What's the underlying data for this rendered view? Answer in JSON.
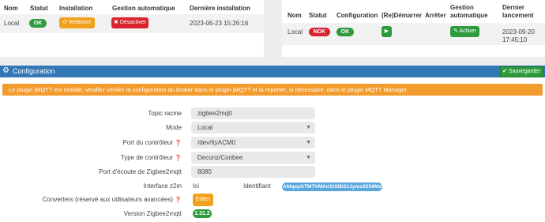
{
  "installation": {
    "headers": {
      "nom": "Nom",
      "statut": "Statut",
      "installation": "Installation",
      "gestion": "Gestion automatique",
      "derniere": "Dernière installation"
    },
    "row": {
      "nom": "Local",
      "statut": "OK",
      "relancer": "Relancer",
      "desactiver": "Désactiver",
      "date": "2023-06-23 15:26:16"
    }
  },
  "demon": {
    "headers": {
      "nom": "Nom",
      "statut": "Statut",
      "configuration": "Configuration",
      "redemarrer": "(Re)Démarrer",
      "arreter": "Arrêter",
      "gestion_l1": "Gestion",
      "gestion_l2": "automatique",
      "dernier_l1": "Dernier",
      "dernier_l2": "lancement"
    },
    "row": {
      "nom": "Local",
      "statut": "NOK",
      "configuration": "OK",
      "activer": "Activer",
      "date_l1": "2023-09-20",
      "date_l2": "17:45:10"
    }
  },
  "config": {
    "title": "Configuration",
    "save_label": "Sauvegarder",
    "alert": "Le plugin jMQTT est installé, veuillez vérifier la configuration du broker dans le plugin jMQTT et la reporter, si nécessaire, dans le plugin MQTT Manager.",
    "fields": {
      "topic_label": "Topic racine",
      "topic_value": "zigbee2mqtt",
      "mode_label": "Mode",
      "mode_value": "Local",
      "port_label": "Port du contrôleur",
      "port_value": "/dev/ttyACM0",
      "type_label": "Type de contrôleur",
      "type_value": "Deconz/Conbee",
      "ecoute_label": "Port d'écoute de Zigbee2mqtt",
      "ecoute_value": "8080",
      "interface_label": "Interface z2m",
      "interface_value": "Ici",
      "identifiant_label": "Identifiant",
      "identifiant_value": "AfdqepGTMTVMArISiSlDS1Jyms3S58Md",
      "converters_label": "Converters (réservé aux utilisateurs avancées)",
      "converters_button": "Editer",
      "version_label": "Version Zigbee2mqtt",
      "version_value": "1.31.2"
    }
  },
  "colors": {
    "header_blue": "#3477b5",
    "alert_orange": "#f39c2e",
    "ok_green": "#2e9b3c",
    "nok_red": "#d9232e"
  }
}
